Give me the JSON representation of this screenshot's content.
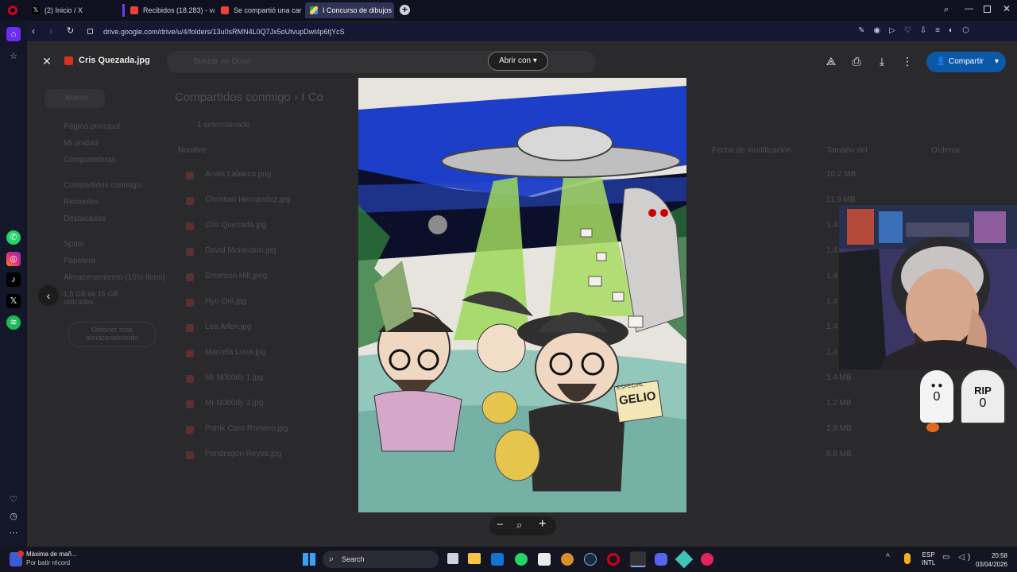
{
  "browser": {
    "tabs": [
      {
        "label": "(2) Inicio / X",
        "icon": "x-icon"
      },
      {
        "label": "Recibidos (18.283) - vacro",
        "icon": "gmail-icon"
      },
      {
        "label": "Se compartió una carpeta",
        "icon": "gmail-icon"
      },
      {
        "label": "I Concurso de dibujos M...",
        "icon": "drive-icon"
      }
    ],
    "url": "drive.google.com/drive/u/4/folders/13u0sRMN4L0Q7Jx5oUtvupDwt4p6tjYcS"
  },
  "viewer": {
    "file_name": "Cris Quezada.jpg",
    "open_with_label": "Abrir con",
    "share_label": "Compartir"
  },
  "drive": {
    "search_placeholder": "Buscar en Drive",
    "new_label": "Nuevo",
    "breadcrumb": "Compartidos conmigo",
    "breadcrumb_current": "I Co",
    "filter_label": "1 seleccionado",
    "columns": {
      "name": "Nombre",
      "owner": "Fecha de modificación",
      "size": "Tamaño del",
      "sort": "Ordenar"
    },
    "nav": [
      "Página principal",
      "Mi unidad",
      "Computadoras",
      "Compartidos conmigo",
      "Recientes",
      "Destacados",
      "Spam",
      "Papelera",
      "Almacenamiento (10% lleno)"
    ],
    "storage_text": "1,5 GB de 15 GB utilizados",
    "get_storage": "Obtener más almacenamiento",
    "files": [
      {
        "name": "Anais Labarca.png",
        "size": "10,2 MB"
      },
      {
        "name": "Christian Hernandez.jpg",
        "size": "11,9 MB"
      },
      {
        "name": "Cris Quezada.jpg",
        "size": "1,4 MB"
      },
      {
        "name": "David Morandon.jpg",
        "size": "1,4 MB"
      },
      {
        "name": "Emerson Hill.jpeg",
        "size": "1,4 MB"
      },
      {
        "name": "Hyo Gril.jpg",
        "size": "1,4 MB"
      },
      {
        "name": "Lea Arlen.jpg",
        "size": "1,4 MB"
      },
      {
        "name": "Marcela Luna.jpg",
        "size": "1,4 MB"
      },
      {
        "name": "Mr N0b0dy 1.jpg",
        "size": "1,4 MB"
      },
      {
        "name": "Mr N0b0dy 2.jpg",
        "size": "1,2 MB"
      },
      {
        "name": "Patrik Caro Romero.jpg",
        "size": "2,8 MB"
      },
      {
        "name": "Pendragon Reyes.jpg",
        "size": "8,8 MB"
      }
    ]
  },
  "overlay": {
    "ghost_count": "0",
    "rip_label": "RIP",
    "rip_count": "0"
  },
  "art_labels": {
    "sign": "ESPECIAL",
    "word": "GELIO"
  },
  "taskbar": {
    "notif_title": "Máxima de mañ...",
    "notif_sub": "Por batir récord",
    "search_label": "Search",
    "lang": "ESP",
    "lang2": "INTL",
    "time": "20:58",
    "date": "03/04/2026"
  },
  "colors": {
    "accent": "#0b57a8",
    "bg": "#1c1c1e"
  }
}
